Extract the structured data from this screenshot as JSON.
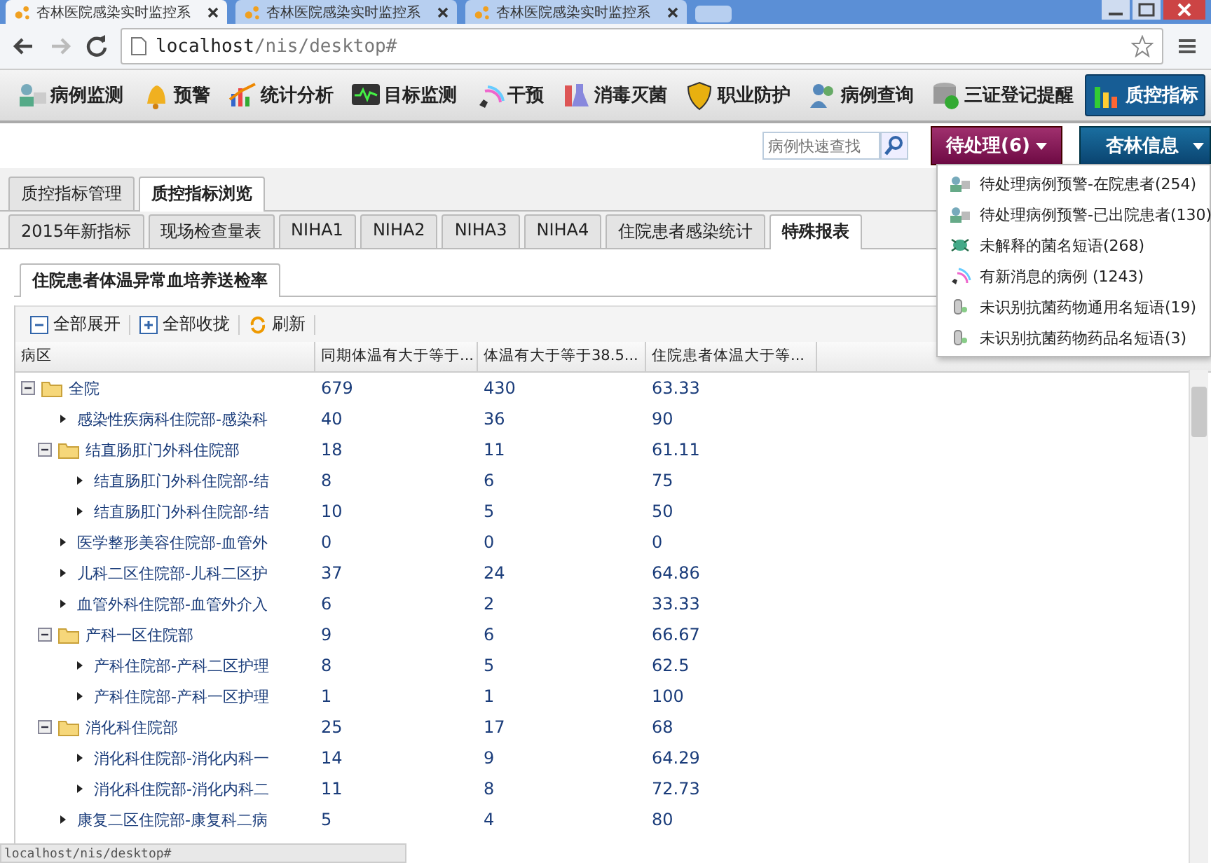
{
  "browser": {
    "tabs": [
      {
        "title": "杏林医院感染实时监控系",
        "selected": true
      },
      {
        "title": "杏林医院感染实时监控系",
        "selected": false
      },
      {
        "title": "杏林医院感染实时监控系",
        "selected": false
      }
    ],
    "address": {
      "host": "localhost",
      "path": "/nis/desktop#"
    },
    "status_url": "localhost/nis/desktop#"
  },
  "nav": [
    {
      "label": "病例监测",
      "kind": "case",
      "selected": false
    },
    {
      "label": "预警",
      "kind": "bell",
      "selected": false
    },
    {
      "label": "统计分析",
      "kind": "chart",
      "selected": false
    },
    {
      "label": "目标监测",
      "kind": "monitor",
      "selected": false
    },
    {
      "label": "干预",
      "kind": "phone",
      "selected": false
    },
    {
      "label": "消毒灭菌",
      "kind": "flask",
      "selected": false
    },
    {
      "label": "职业防护",
      "kind": "shield",
      "selected": false
    },
    {
      "label": "病例查询",
      "kind": "people",
      "selected": false
    },
    {
      "label": "三证登记提醒",
      "kind": "database",
      "selected": false
    },
    {
      "label": "质控指标",
      "kind": "bars",
      "selected": true
    }
  ],
  "search": {
    "placeholder": "病例快速查找"
  },
  "pending_button": "待处理(6)",
  "user_button": "杏林信息",
  "pending_menu": [
    {
      "label": "待处理病例预警-在院患者(254)",
      "kind": "case"
    },
    {
      "label": "待处理病例预警-已出院患者(130)",
      "kind": "case"
    },
    {
      "label": "未解释的菌名短语(268)",
      "kind": "germ"
    },
    {
      "label": "有新消息的病例 (1243)",
      "kind": "message"
    },
    {
      "label": "未识别抗菌药物通用名短语(19)",
      "kind": "drug"
    },
    {
      "label": "未识别抗菌药物药品名短语(3)",
      "kind": "drug"
    }
  ],
  "main_tabs": [
    {
      "label": "质控指标管理",
      "selected": false
    },
    {
      "label": "质控指标浏览",
      "selected": true
    }
  ],
  "sub_tabs": [
    {
      "label": "2015年新指标",
      "selected": false
    },
    {
      "label": "现场检查量表",
      "selected": false
    },
    {
      "label": "NIHA1",
      "selected": false
    },
    {
      "label": "NIHA2",
      "selected": false
    },
    {
      "label": "NIHA3",
      "selected": false
    },
    {
      "label": "NIHA4",
      "selected": false
    },
    {
      "label": "住院患者感染统计",
      "selected": false
    },
    {
      "label": "特殊报表",
      "selected": true
    }
  ],
  "report_tab": "住院患者体温异常血培养送检率",
  "toolbar": [
    {
      "label": "全部展开",
      "kind": "expand"
    },
    {
      "label": "全部收拢",
      "kind": "collapse"
    },
    {
      "label": "刷新",
      "kind": "refresh"
    }
  ],
  "table": {
    "columns": [
      "病区",
      "同期体温有大于等于...",
      "体温有大于等于38.5...",
      "住院患者体温大于等..."
    ],
    "rows": [
      {
        "cells": [
          "全院",
          "679",
          "430",
          "63.33"
        ],
        "expanded": true,
        "children": [
          {
            "cells": [
              "感染性疾病科住院部-感染科",
              "40",
              "36",
              "90"
            ],
            "expanded": false
          },
          {
            "cells": [
              "结直肠肛门外科住院部",
              "18",
              "11",
              "61.11"
            ],
            "expanded": true,
            "children": [
              {
                "cells": [
                  "结直肠肛门外科住院部-结",
                  "8",
                  "6",
                  "75"
                ],
                "expanded": false
              },
              {
                "cells": [
                  "结直肠肛门外科住院部-结",
                  "10",
                  "5",
                  "50"
                ],
                "expanded": false
              }
            ]
          },
          {
            "cells": [
              "医学整形美容住院部-血管外",
              "0",
              "0",
              "0"
            ],
            "expanded": false
          },
          {
            "cells": [
              "儿科二区住院部-儿科二区护",
              "37",
              "24",
              "64.86"
            ],
            "expanded": false
          },
          {
            "cells": [
              "血管外科住院部-血管外介入",
              "6",
              "2",
              "33.33"
            ],
            "expanded": false
          },
          {
            "cells": [
              "产科一区住院部",
              "9",
              "6",
              "66.67"
            ],
            "expanded": true,
            "children": [
              {
                "cells": [
                  "产科住院部-产科二区护理",
                  "8",
                  "5",
                  "62.5"
                ],
                "expanded": false
              },
              {
                "cells": [
                  "产科住院部-产科一区护理",
                  "1",
                  "1",
                  "100"
                ],
                "expanded": false
              }
            ]
          },
          {
            "cells": [
              "消化科住院部",
              "25",
              "17",
              "68"
            ],
            "expanded": true,
            "children": [
              {
                "cells": [
                  "消化科住院部-消化内科一",
                  "14",
                  "9",
                  "64.29"
                ],
                "expanded": false
              },
              {
                "cells": [
                  "消化科住院部-消化内科二",
                  "11",
                  "8",
                  "72.73"
                ],
                "expanded": false
              }
            ]
          },
          {
            "cells": [
              "康复二区住院部-康复科二病",
              "5",
              "4",
              "80"
            ],
            "expanded": false
          }
        ]
      }
    ]
  }
}
